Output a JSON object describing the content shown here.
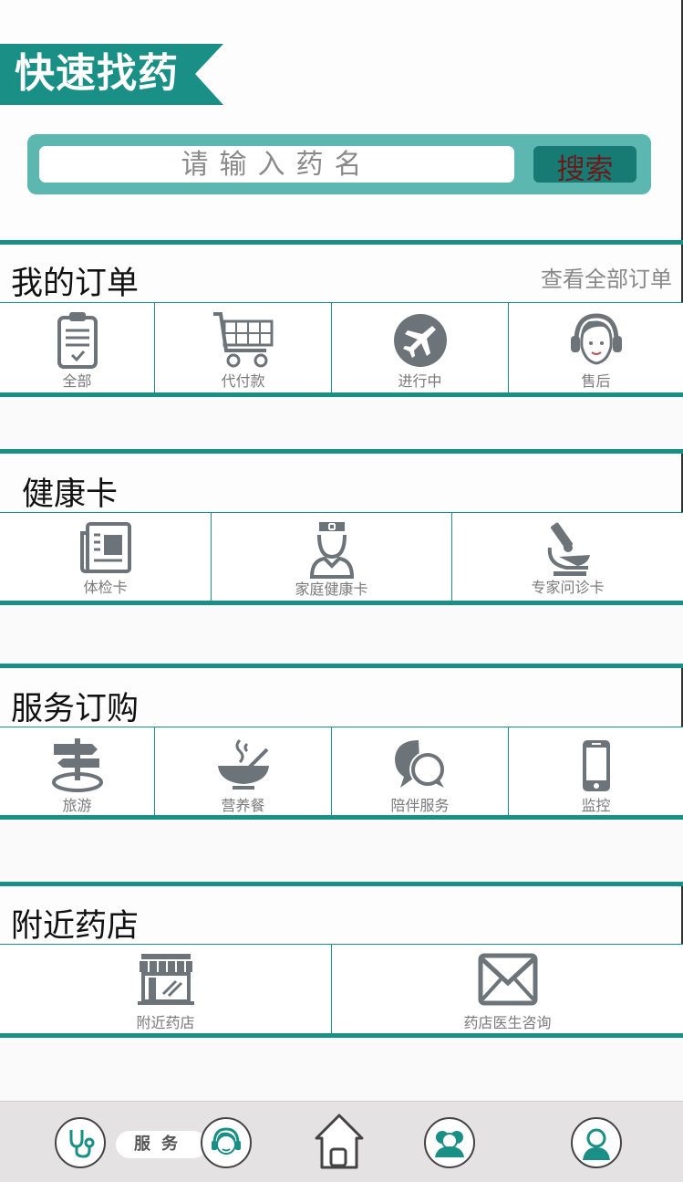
{
  "header": {
    "title": "快速找药"
  },
  "search": {
    "placeholder": "请输入药名",
    "button_label": "搜索"
  },
  "orders": {
    "title": "我的订单",
    "view_all": "查看全部订单",
    "items": [
      {
        "label": "全部",
        "icon": "clipboard-icon"
      },
      {
        "label": "代付款",
        "icon": "cart-icon"
      },
      {
        "label": "进行中",
        "icon": "plane-icon"
      },
      {
        "label": "售后",
        "icon": "headset-agent-icon"
      }
    ]
  },
  "health_card": {
    "title": "健康卡",
    "items": [
      {
        "label": "体检卡",
        "icon": "newspaper-icon"
      },
      {
        "label": "家庭健康卡",
        "icon": "nurse-icon"
      },
      {
        "label": "专家问诊卡",
        "icon": "microscope-icon"
      }
    ]
  },
  "services": {
    "title": "服务订购",
    "items": [
      {
        "label": "旅游",
        "icon": "signpost-icon"
      },
      {
        "label": "营养餐",
        "icon": "bowl-icon"
      },
      {
        "label": "陪伴服务",
        "icon": "chat-bubbles-icon"
      },
      {
        "label": "监控",
        "icon": "phone-icon"
      }
    ]
  },
  "nearby": {
    "title": "附近药店",
    "items": [
      {
        "label": "附近药店",
        "icon": "store-icon"
      },
      {
        "label": "药店医生咨询",
        "icon": "envelope-icon"
      }
    ]
  },
  "bottom_nav": {
    "service_label": "服务",
    "items": [
      "stethoscope-icon",
      "headset-icon",
      "home-icon",
      "group-icon",
      "user-icon"
    ]
  },
  "colors": {
    "teal": "#1a8f86",
    "teal_light": "#5cb7b0",
    "icon_gray": "#6d7479"
  }
}
